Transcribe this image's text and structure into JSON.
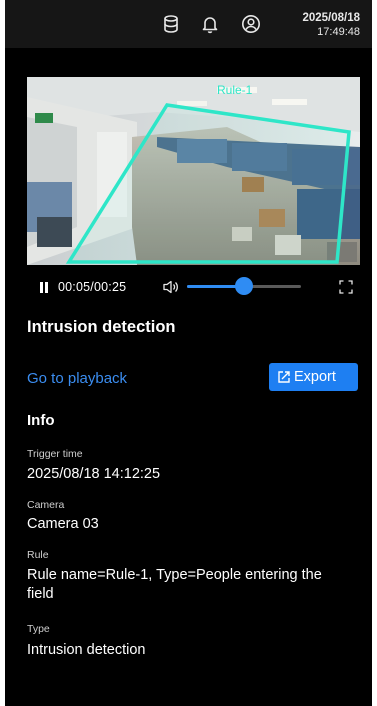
{
  "header": {
    "date": "2025/08/18",
    "time": "17:49:48",
    "icons": [
      "database-icon",
      "bell-icon",
      "user-icon"
    ]
  },
  "video": {
    "overlay_label": "Rule-1",
    "current_time": "00:05",
    "duration": "00:25",
    "time_separator": "/",
    "volume_level": 0.5,
    "accent_color": "#2f8cf3",
    "zone_color": "#2ee6c8"
  },
  "event": {
    "title": "Intrusion detection",
    "playback_link": "Go to playback",
    "export_label": "Export"
  },
  "info": {
    "heading": "Info",
    "fields": [
      {
        "label": "Trigger time",
        "value": "2025/08/18 14:12:25"
      },
      {
        "label": "Camera",
        "value": "Camera 03"
      },
      {
        "label": "Rule",
        "value": "Rule name=Rule-1, Type=People entering the field"
      },
      {
        "label": "Type",
        "value": "Intrusion detection"
      }
    ]
  }
}
